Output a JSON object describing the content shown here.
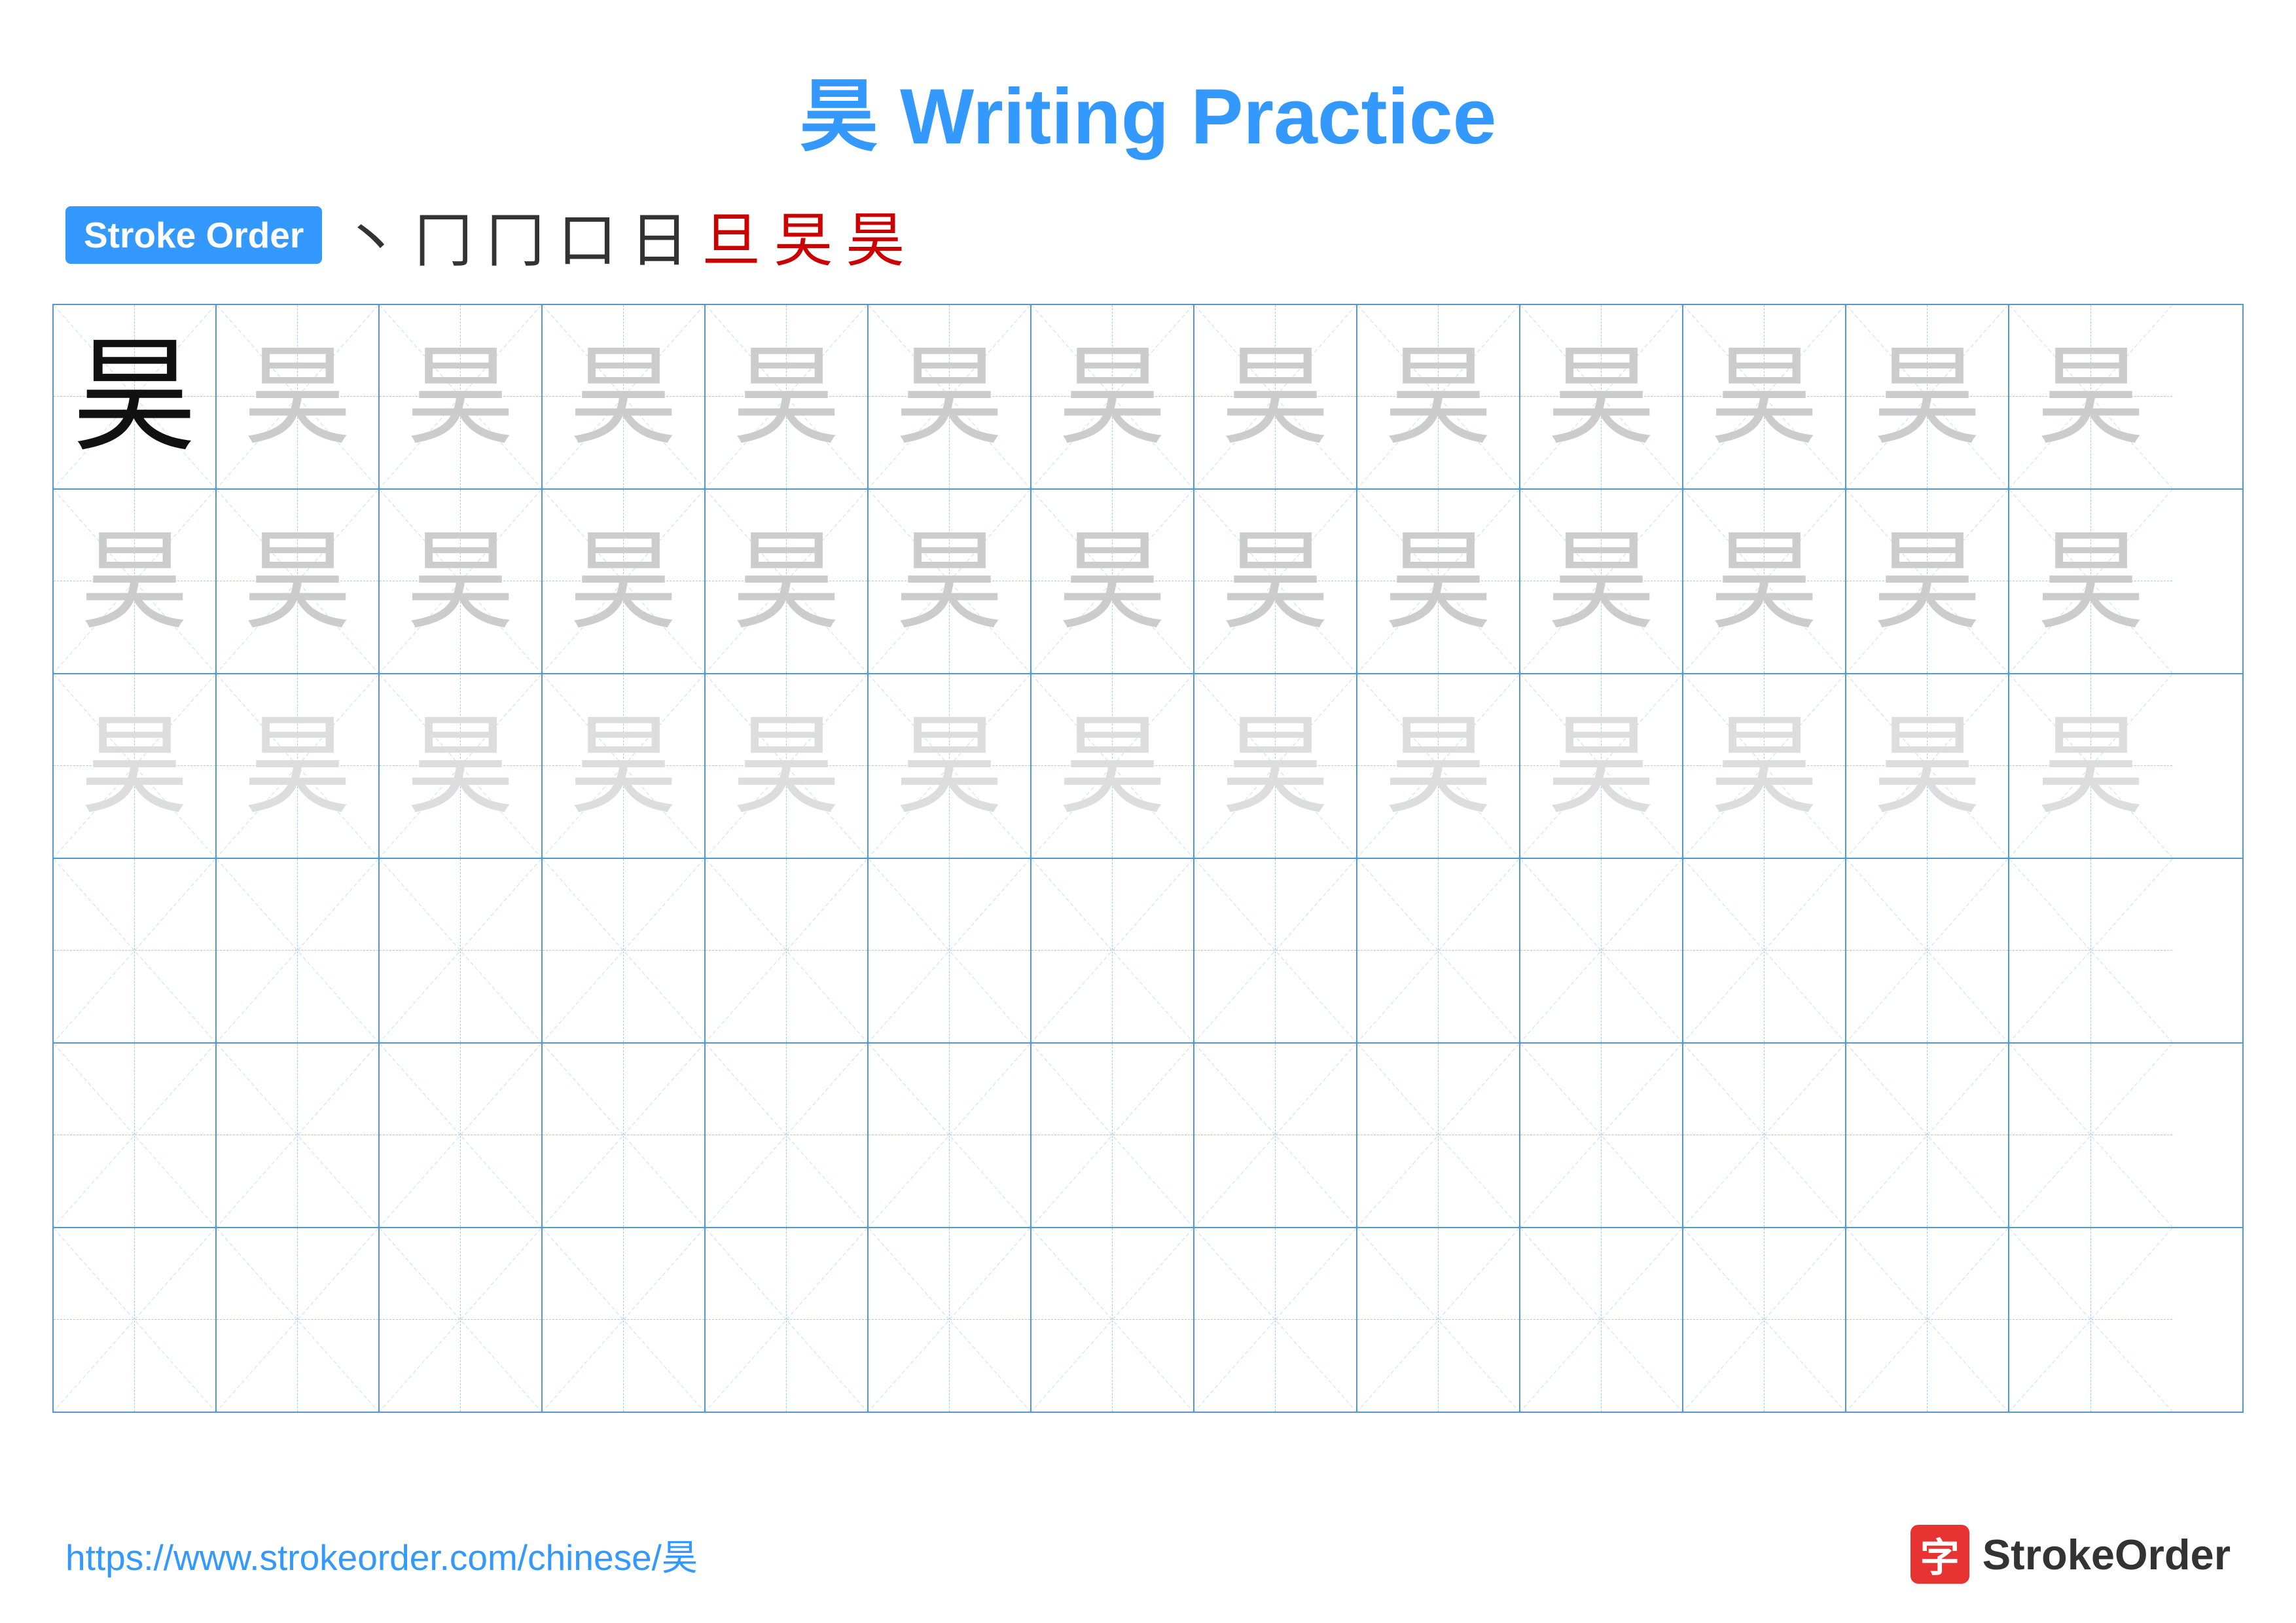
{
  "title": {
    "char": "昊",
    "text": " Writing Practice"
  },
  "stroke_order": {
    "badge_label": "Stroke Order",
    "strokes": [
      "丶",
      "𠃍",
      "冂",
      "口",
      "日",
      "旦",
      "旲",
      "昊"
    ],
    "red_indices": [
      5,
      6,
      7
    ]
  },
  "grid": {
    "rows": 6,
    "cols": 13,
    "char": "昊",
    "filled_rows": [
      {
        "type": "full+faint1",
        "full_col": 0
      },
      {
        "type": "faint2"
      },
      {
        "type": "faint3"
      },
      {
        "type": "empty"
      },
      {
        "type": "empty"
      },
      {
        "type": "empty"
      }
    ]
  },
  "footer": {
    "url": "https://www.strokeorder.com/chinese/昊",
    "logo_icon": "字",
    "logo_text": "StrokeOrder"
  }
}
